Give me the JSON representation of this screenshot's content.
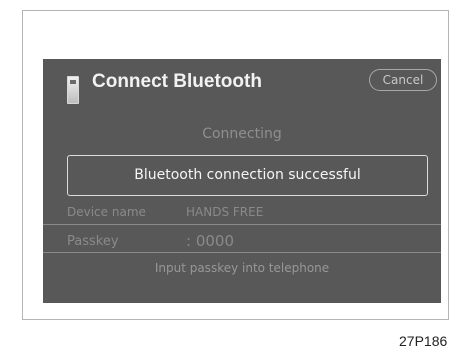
{
  "window": {
    "title": "Connect Bluetooth",
    "cancel_label": "Cancel",
    "phone_icon": "phone-icon"
  },
  "status": {
    "connecting_label": "Connecting"
  },
  "dialog": {
    "message": "Bluetooth connection successful"
  },
  "device": {
    "label": "Device name",
    "value": "HANDS FREE"
  },
  "passkey": {
    "label": "Passkey",
    "value": ": 0000",
    "hint": "Input passkey into telephone"
  },
  "figure": {
    "code": "27P186"
  }
}
